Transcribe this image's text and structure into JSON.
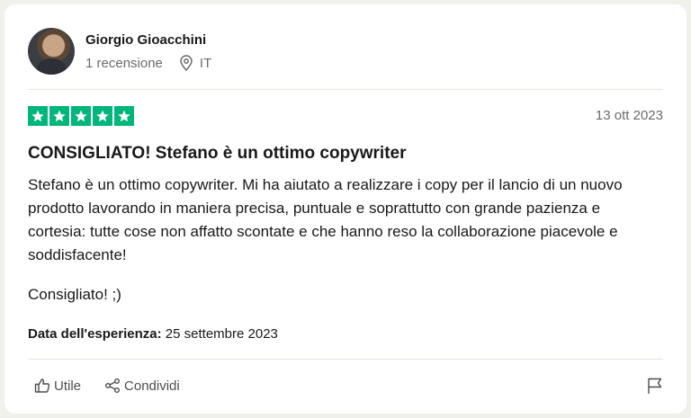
{
  "reviewer": {
    "name": "Giorgio Gioacchini",
    "review_count": "1 recensione",
    "country": "IT"
  },
  "rating": {
    "stars": 5,
    "max": 5,
    "color": "#00b67a"
  },
  "review": {
    "date": "13 ott 2023",
    "title": "CONSIGLIATO! Stefano è un ottimo copywriter",
    "body": "Stefano è un ottimo copywriter. Mi ha aiutato a realizzare i copy per il lancio di un nuovo prodotto lavorando in maniera precisa, puntuale e soprattutto con grande pazienza e cortesia: tutte cose non affatto scontate e che hanno reso la collaborazione piacevole e soddisfacente!",
    "closing": "Consigliato! ;)",
    "experience_label": "Data dell'esperienza:",
    "experience_date": "25 settembre 2023"
  },
  "actions": {
    "useful_label": "Utile",
    "share_label": "Condividi"
  },
  "icons": {
    "location": "location-pin-icon",
    "useful": "thumbs-up-icon",
    "share": "share-icon",
    "report": "flag-icon",
    "star": "star-icon"
  }
}
